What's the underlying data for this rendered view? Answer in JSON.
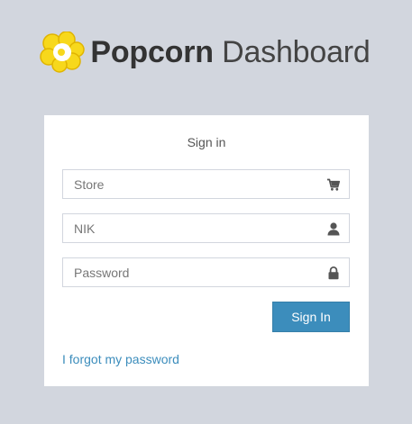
{
  "brand": {
    "name_bold": "Popcorn",
    "name_light": "Dashboard",
    "icon": "popcorn-icon",
    "icon_color": "#f5d21a"
  },
  "login": {
    "message": "Sign in",
    "store": {
      "placeholder": "Store",
      "value": "",
      "icon": "cart-icon"
    },
    "nik": {
      "placeholder": "NIK",
      "value": "",
      "icon": "user-icon"
    },
    "password": {
      "placeholder": "Password",
      "value": "",
      "icon": "lock-icon"
    },
    "submit_label": "Sign In",
    "forgot_label": "I forgot my password"
  },
  "colors": {
    "background": "#d2d6de",
    "accent": "#3c8dbc",
    "icon": "#555555"
  }
}
